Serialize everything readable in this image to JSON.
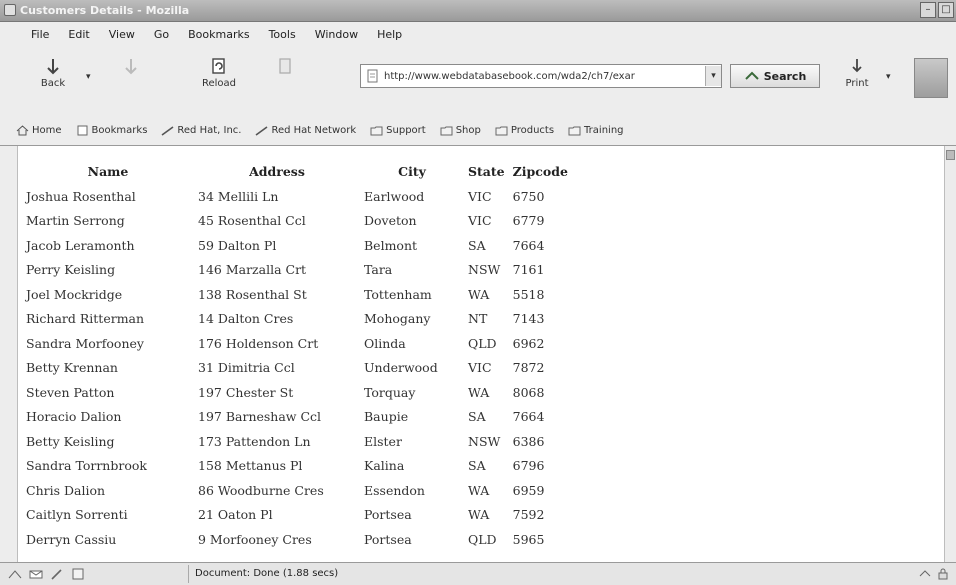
{
  "window": {
    "title": "Customers Details - Mozilla",
    "controls": [
      "–",
      "□"
    ]
  },
  "menu": [
    "File",
    "Edit",
    "View",
    "Go",
    "Bookmarks",
    "Tools",
    "Window",
    "Help"
  ],
  "toolbar": {
    "back_label": "Back",
    "forward_label": "",
    "reload_label": "Reload",
    "stop_label": "",
    "url": "http://www.webdatabasebook.com/wda2/ch7/exar",
    "search_label": "Search",
    "print_label": "Print"
  },
  "bookmarks": [
    "Home",
    "Bookmarks",
    "Red Hat, Inc.",
    "Red Hat Network",
    "Support",
    "Shop",
    "Products",
    "Training"
  ],
  "table": {
    "headers": [
      "Name",
      "Address",
      "City",
      "State",
      "Zipcode"
    ],
    "rows": [
      [
        "Joshua Rosenthal",
        "34 Mellili Ln",
        "Earlwood",
        "VIC",
        "6750"
      ],
      [
        "Martin Serrong",
        "45 Rosenthal Ccl",
        "Doveton",
        "VIC",
        "6779"
      ],
      [
        "Jacob Leramonth",
        "59 Dalton Pl",
        "Belmont",
        "SA",
        "7664"
      ],
      [
        "Perry Keisling",
        "146 Marzalla Crt",
        "Tara",
        "NSW",
        "7161"
      ],
      [
        "Joel Mockridge",
        "138 Rosenthal St",
        "Tottenham",
        "WA",
        "5518"
      ],
      [
        "Richard Ritterman",
        "14 Dalton Cres",
        "Mohogany",
        "NT",
        "7143"
      ],
      [
        "Sandra Morfooney",
        "176 Holdenson Crt",
        "Olinda",
        "QLD",
        "6962"
      ],
      [
        "Betty Krennan",
        "31 Dimitria Ccl",
        "Underwood",
        "VIC",
        "7872"
      ],
      [
        "Steven Patton",
        "197 Chester St",
        "Torquay",
        "WA",
        "8068"
      ],
      [
        "Horacio Dalion",
        "197 Barneshaw Ccl",
        "Baupie",
        "SA",
        "7664"
      ],
      [
        "Betty Keisling",
        "173 Pattendon Ln",
        "Elster",
        "NSW",
        "6386"
      ],
      [
        "Sandra Torrnbrook",
        "158 Mettanus Pl",
        "Kalina",
        "SA",
        "6796"
      ],
      [
        "Chris Dalion",
        "86 Woodburne Cres",
        "Essendon",
        "WA",
        "6959"
      ],
      [
        "Caitlyn Sorrenti",
        "21 Oaton Pl",
        "Portsea",
        "WA",
        "7592"
      ],
      [
        "Derryn Cassiu",
        "9 Morfooney Cres",
        "Portsea",
        "QLD",
        "5965"
      ]
    ]
  },
  "status": {
    "text": "Document: Done (1.88 secs)"
  },
  "colors": {
    "chrome": "#ededed",
    "titlebar": "#a8a8a8",
    "text": "#333333"
  }
}
